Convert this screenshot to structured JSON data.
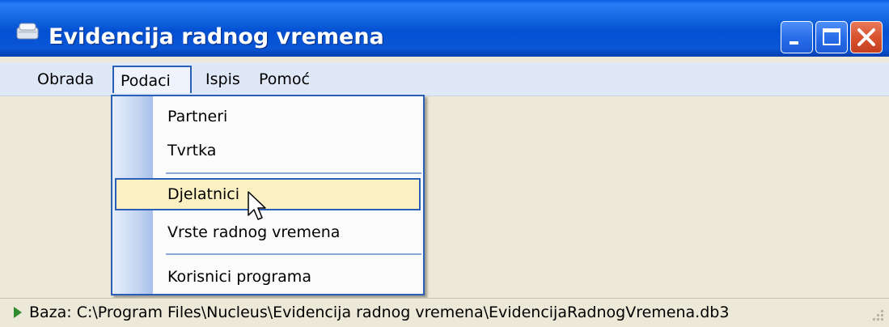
{
  "window": {
    "title": "Evidencija radnog vremena"
  },
  "menubar": {
    "items": [
      {
        "label": "Obrada"
      },
      {
        "label": "Podaci"
      },
      {
        "label": "Ispis"
      },
      {
        "label": "Pomoć"
      }
    ],
    "open_menu": "Podaci"
  },
  "dropdown": {
    "items": [
      {
        "label": "Partneri"
      },
      {
        "label": "Tvrtka"
      },
      {
        "label": "Djelatnici",
        "state": "hover"
      },
      {
        "label": "Vrste radnog vremena"
      },
      {
        "label": "Korisnici programa"
      }
    ]
  },
  "statusbar": {
    "text": "Baza: C:\\Program Files\\Nucleus\\Evidencija radnog vremena\\EvidencijaRadnogVremena.db3"
  },
  "colors": {
    "titlebar": "#0a56d6",
    "menubar": "#dfe8f7",
    "hover_bg": "#fbf0c2",
    "accent_border": "#2a5fb8",
    "window_bg": "#ece9d8"
  },
  "icons": [
    "app-icon",
    "minimize-icon",
    "maximize-icon",
    "close-icon",
    "status-arrow-icon",
    "size-grip-icon",
    "mouse-cursor-icon"
  ]
}
